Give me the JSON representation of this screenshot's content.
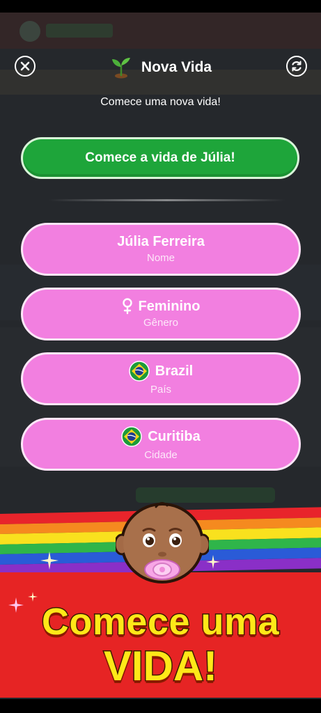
{
  "header": {
    "title": "Nova Vida",
    "subtitle": "Comece uma nova vida!",
    "close_icon": "close-icon",
    "reload_icon": "refresh-icon",
    "title_icon": "sprout-icon"
  },
  "start_button": {
    "label": "Comece a vida de Júlia!"
  },
  "options": [
    {
      "value": "Júlia Ferreira",
      "label": "Nome",
      "icon": ""
    },
    {
      "value": "Feminino",
      "label": "Gênero",
      "icon": "female-symbol-icon"
    },
    {
      "value": "Brazil",
      "label": "País",
      "icon": "brazil-flag-icon"
    },
    {
      "value": "Curitiba",
      "label": "Cidade",
      "icon": "brazil-flag-icon"
    }
  ],
  "banner": {
    "line1": "Comece uma",
    "line2": "VIDA!",
    "mascot_icon": "baby-pacifier-icon"
  },
  "colors": {
    "start_green": "#1ea53a",
    "option_pink": "#f27fe0",
    "banner_red": "#e62424",
    "banner_text_yellow": "#ffe818"
  }
}
